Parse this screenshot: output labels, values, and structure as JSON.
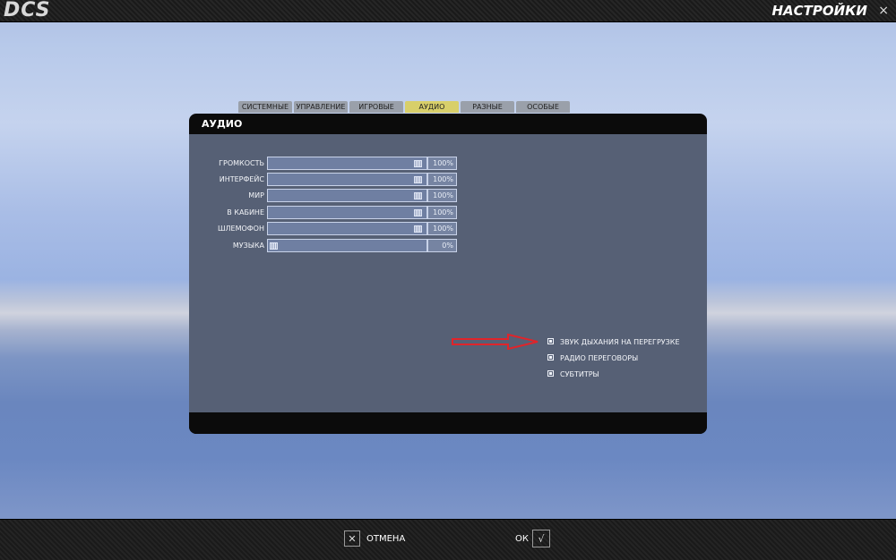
{
  "app": {
    "logo": "DCS",
    "title": "НАСТРОЙКИ",
    "close_symbol": "×"
  },
  "tabs": [
    {
      "label": "СИСТЕМНЫЕ",
      "active": false
    },
    {
      "label": "УПРАВЛЕНИЕ",
      "active": false
    },
    {
      "label": "ИГРОВЫЕ",
      "active": false
    },
    {
      "label": "АУДИО",
      "active": true
    },
    {
      "label": "РАЗНЫЕ",
      "active": false
    },
    {
      "label": "ОСОБЫЕ",
      "active": false
    }
  ],
  "panel": {
    "title": "АУДИО"
  },
  "sliders": [
    {
      "label": "ГРОМКОСТЬ",
      "value": "100%"
    },
    {
      "label": "ИНТЕРФЕЙС",
      "value": "100%"
    },
    {
      "label": "МИР",
      "value": "100%"
    },
    {
      "label": "В КАБИНЕ",
      "value": "100%"
    },
    {
      "label": "ШЛЕМОФОН",
      "value": "100%"
    },
    {
      "label": "МУЗЫКА",
      "value": "0%"
    }
  ],
  "checkboxes": [
    {
      "label": "ЗВУК ДЫХАНИЯ НА ПЕРЕГРУЗКЕ",
      "checked": true
    },
    {
      "label": "РАДИО ПЕРЕГОВОРЫ",
      "checked": true
    },
    {
      "label": "СУБТИТРЫ",
      "checked": true
    }
  ],
  "footer": {
    "cancel_label": "ОТМЕНА",
    "cancel_symbol": "✕",
    "ok_label": "ОК",
    "ok_symbol": "√"
  },
  "colors": {
    "active_tab": "#d8cf6a",
    "annotation_arrow": "#e0242a"
  }
}
